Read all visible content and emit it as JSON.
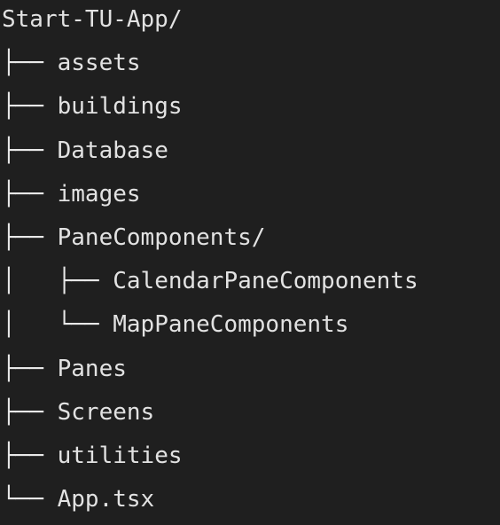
{
  "tree": {
    "root": "Start-TU-App/",
    "lines": [
      {
        "prefix": "├── ",
        "name": "assets"
      },
      {
        "prefix": "├── ",
        "name": "buildings"
      },
      {
        "prefix": "├── ",
        "name": "Database"
      },
      {
        "prefix": "├── ",
        "name": "images"
      },
      {
        "prefix": "├── ",
        "name": "PaneComponents/"
      },
      {
        "prefix": "│   ├── ",
        "name": "CalendarPaneComponents"
      },
      {
        "prefix": "│   └── ",
        "name": "MapPaneComponents"
      },
      {
        "prefix": "├── ",
        "name": "Panes"
      },
      {
        "prefix": "├── ",
        "name": "Screens"
      },
      {
        "prefix": "├── ",
        "name": "utilities"
      },
      {
        "prefix": "└── ",
        "name": "App.tsx"
      }
    ]
  }
}
